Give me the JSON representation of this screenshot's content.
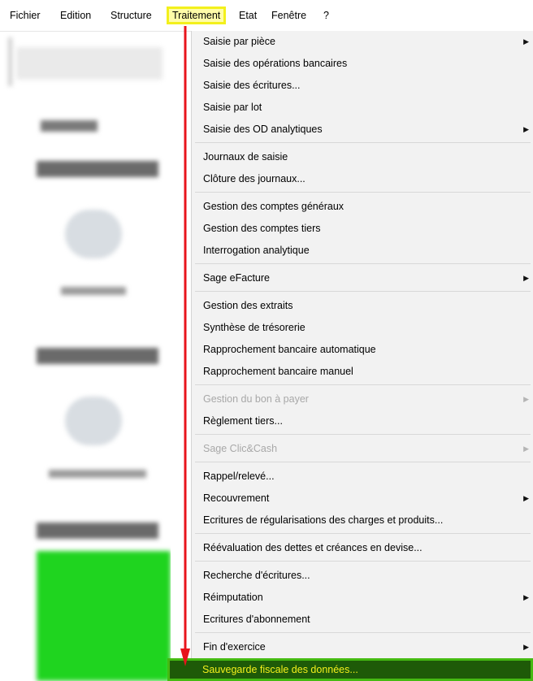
{
  "menubar": {
    "items": [
      "Fichier",
      "Edition",
      "Structure",
      "Traitement",
      "Etat",
      "Fenêtre",
      "?"
    ]
  },
  "menu": {
    "items": [
      {
        "label": "Saisie par pièce",
        "submenu": true,
        "disabled": false
      },
      {
        "label": "Saisie des opérations bancaires",
        "submenu": false,
        "disabled": false
      },
      {
        "label": "Saisie des écritures...",
        "submenu": false,
        "disabled": false
      },
      {
        "label": "Saisie par lot",
        "submenu": false,
        "disabled": false
      },
      {
        "label": "Saisie des OD analytiques",
        "submenu": true,
        "disabled": false
      },
      {
        "label": "Journaux de saisie",
        "submenu": false,
        "disabled": false
      },
      {
        "label": "Clôture des journaux...",
        "submenu": false,
        "disabled": false
      },
      {
        "label": "Gestion des comptes généraux",
        "submenu": false,
        "disabled": false
      },
      {
        "label": "Gestion des comptes tiers",
        "submenu": false,
        "disabled": false
      },
      {
        "label": "Interrogation analytique",
        "submenu": false,
        "disabled": false
      },
      {
        "label": "Sage eFacture",
        "submenu": true,
        "disabled": false
      },
      {
        "label": "Gestion des extraits",
        "submenu": false,
        "disabled": false
      },
      {
        "label": "Synthèse de trésorerie",
        "submenu": false,
        "disabled": false
      },
      {
        "label": "Rapprochement bancaire automatique",
        "submenu": false,
        "disabled": false
      },
      {
        "label": "Rapprochement bancaire manuel",
        "submenu": false,
        "disabled": false
      },
      {
        "label": "Gestion du bon à payer",
        "submenu": true,
        "disabled": true
      },
      {
        "label": "Règlement tiers...",
        "submenu": false,
        "disabled": false
      },
      {
        "label": "Sage Clic&Cash",
        "submenu": true,
        "disabled": true
      },
      {
        "label": "Rappel/relevé...",
        "submenu": false,
        "disabled": false
      },
      {
        "label": "Recouvrement",
        "submenu": true,
        "disabled": false
      },
      {
        "label": "Ecritures de régularisations des charges et produits...",
        "submenu": false,
        "disabled": false
      },
      {
        "label": "Réévaluation des dettes et créances en devise...",
        "submenu": false,
        "disabled": false
      },
      {
        "label": "Recherche d'écritures...",
        "submenu": false,
        "disabled": false
      },
      {
        "label": "Réimputation",
        "submenu": true,
        "disabled": false
      },
      {
        "label": "Ecritures d'abonnement",
        "submenu": false,
        "disabled": false
      },
      {
        "label": "Fin d'exercice",
        "submenu": true,
        "disabled": false
      }
    ],
    "highlighted_item": "Sauvegarde fiscale des données...",
    "arrow_glyph": "▶"
  },
  "colors": {
    "menu_highlight_yellow": "#f3f01c",
    "annotation_red": "#e8141c",
    "last_item_bg": "#1e5a08",
    "last_item_border": "#45ba12",
    "sidebar_tile_green": "#1fd41f"
  }
}
